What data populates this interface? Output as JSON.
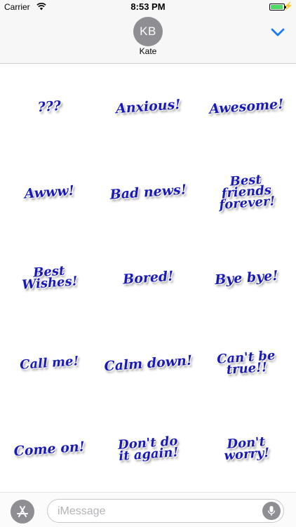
{
  "status_bar": {
    "carrier": "Carrier",
    "time": "8:53 PM",
    "battery_percent": 95
  },
  "header": {
    "avatar_initials": "KB",
    "contact_name": "Kate",
    "collapse_icon": "chevron-down-icon",
    "accent_color": "#1a7cf5"
  },
  "stickers": [
    {
      "label": "???"
    },
    {
      "label": "Anxious!"
    },
    {
      "label": "Awesome!"
    },
    {
      "label": "Awww!"
    },
    {
      "label": "Bad news!"
    },
    {
      "label": "Best friends forever!"
    },
    {
      "label": "Best Wishes!"
    },
    {
      "label": "Bored!"
    },
    {
      "label": "Bye bye!"
    },
    {
      "label": "Call me!"
    },
    {
      "label": "Calm down!"
    },
    {
      "label": "Can't be true!!"
    },
    {
      "label": "Come on!"
    },
    {
      "label": "Don't do it again!"
    },
    {
      "label": "Don't worry!"
    }
  ],
  "sticker_color": "#1a1ab8",
  "compose": {
    "apps_icon": "app-store-icon",
    "placeholder": "iMessage",
    "mic_icon": "microphone-icon"
  }
}
